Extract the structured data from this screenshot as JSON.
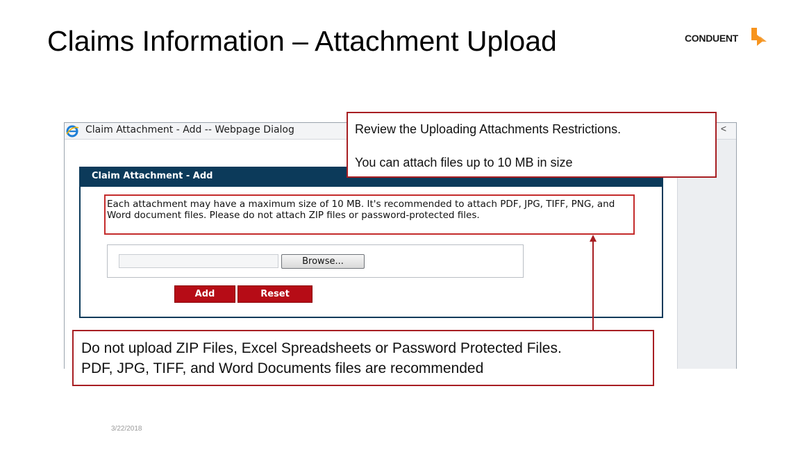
{
  "slide": {
    "title": "Claims Information – Attachment Upload",
    "date": "3/22/2018"
  },
  "logo": {
    "text": "CONDUENT",
    "mark_icon": "conduent-mark-icon",
    "accent_color": "#f7941d"
  },
  "dialog": {
    "window_title": "Claim Attachment - Add -- Webpage Dialog",
    "window_icon": "ie-icon",
    "close_glyph": "<",
    "panel_title": "Claim Attachment - Add",
    "panel_color": "#0c3a5a",
    "note": "Each attachment may have a maximum size of 10 MB. It's recommended to attach PDF, JPG, TIFF, PNG, and Word document files. Please do not attach ZIP files or password-protected files.",
    "file_input_value": "",
    "browse_label": "Browse...",
    "add_label": "Add",
    "reset_label": "Reset",
    "button_color": "#b60c16"
  },
  "callouts": {
    "top_line1": "Review the Uploading Attachments Restrictions.",
    "top_line2": "You can attach files up to 10 MB in size",
    "bottom_line1": "Do not upload ZIP Files, Excel Spreadsheets or Password Protected Files.",
    "bottom_line2": "PDF, JPG, TIFF, and Word Documents files are recommended",
    "border_color": "#a71e22"
  }
}
